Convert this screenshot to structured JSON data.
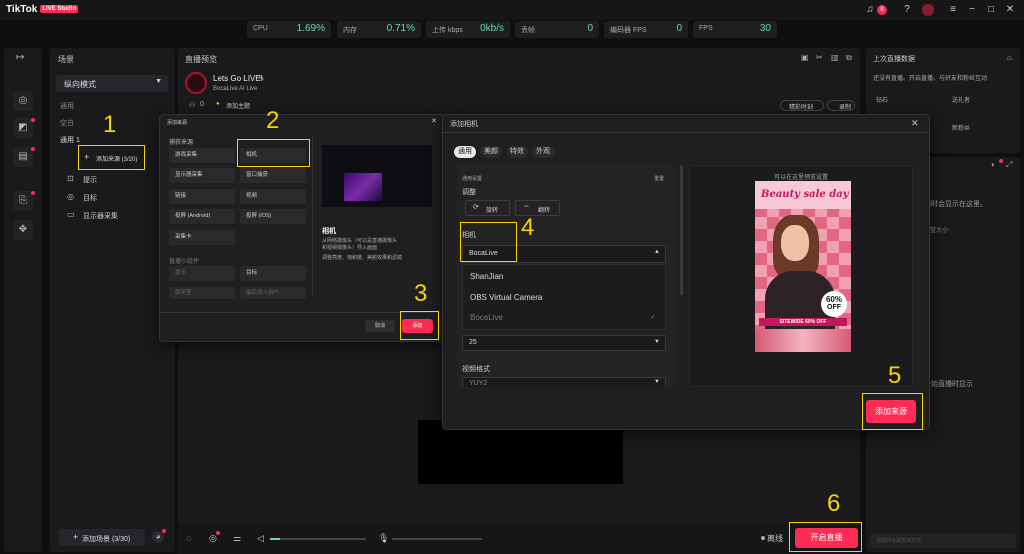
{
  "app": {
    "name": "TikTok",
    "badge": "LIVE Studio",
    "notif_count": "8"
  },
  "metrics": [
    {
      "label": "CPU",
      "value": "1.69%"
    },
    {
      "label": "内存",
      "value": "0.71%"
    },
    {
      "label": "上传 kbps",
      "value": "0kb/s"
    },
    {
      "label": "丢帧",
      "value": "0"
    },
    {
      "label": "编码器 FPS",
      "value": "0"
    },
    {
      "label": "FPS",
      "value": "30"
    }
  ],
  "scenes": {
    "header": "场景",
    "mode": "纵向模式",
    "groups": [
      "通用",
      "空白",
      "通用 1"
    ],
    "add_source": "添加来源 (3/20)",
    "items": [
      "提示",
      "目标",
      "显示器采集"
    ],
    "add_scene": "添加场景 (3/30)"
  },
  "preview": {
    "header": "直播预览",
    "live_title": "Lets Go LIVE!",
    "account": "BocaLive AI Live",
    "viewers": "0",
    "topic": "添加主题",
    "clip_btn": "精彩时刻",
    "record_btn": "录制"
  },
  "right": {
    "header": "上次直播数据",
    "info": "还没有直播。开启直播，与好友和粉丝互动",
    "stats": [
      "钻石",
      "送礼者",
      "—",
      "新粉丝"
    ],
    "mid1": "同时会显示在这里。",
    "mid2": "调整大小",
    "mid3": "开始直播时显示",
    "input_placeholder": "添加评论或查询方式"
  },
  "dlg1": {
    "title": "添加来源",
    "section1": "捕获来源",
    "sources": [
      "游戏采集",
      "相机",
      "显示器采集",
      "窗口捕获",
      "链接",
      "视频",
      "投屏 (Android)",
      "投屏 (iOS)",
      "采集卡"
    ],
    "section2": "直播小组件",
    "widgets": [
      "提示",
      "目标",
      "聊天室",
      "最后加入用户"
    ],
    "preview_title": "相机",
    "preview_desc": "从网络摄像头（可以是直播摄像头和视频摄像头）导入画面",
    "preview_desc2": "调整亮度、饱和度、美颜效果和滤镜",
    "cancel": "取消",
    "add": "添加"
  },
  "dlg2": {
    "title": "添加相机",
    "tabs": [
      "通用",
      "美颜",
      "特效",
      "外观"
    ],
    "general": "通用设置",
    "reset": "重置",
    "adjust": "调整",
    "rotate": "旋转",
    "flip": "翻转",
    "camera_label": "相机",
    "camera_value": "BocaLive",
    "options": [
      "ShanJian",
      "OBS Virtual Camera",
      "BocaLive"
    ],
    "resolution_value": "25",
    "format_label": "视频格式",
    "format_value": "YUY2",
    "preview_hint": "可以在这里预览设置",
    "ad_title": "Beauty sale day",
    "ad_discount": "60%",
    "ad_off": "OFF",
    "ad_sitewide": "SITEWIDE 60% OFF",
    "add_btn": "添加来源"
  },
  "bottom": {
    "mic": "0",
    "offline": "离线",
    "go_live": "开启直播"
  },
  "steps": [
    "1",
    "2",
    "3",
    "4",
    "5",
    "6"
  ]
}
